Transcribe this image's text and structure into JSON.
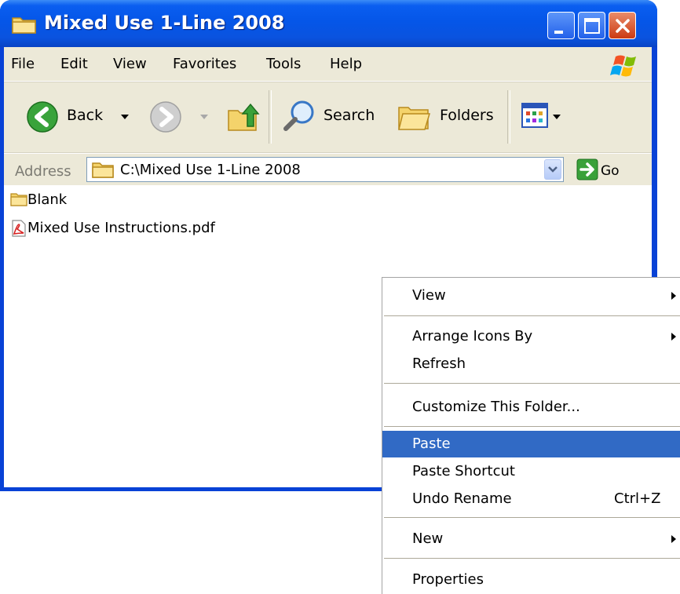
{
  "window": {
    "title": "Mixed Use 1-Line 2008"
  },
  "menubar": {
    "items": [
      "File",
      "Edit",
      "View",
      "Favorites",
      "Tools",
      "Help"
    ]
  },
  "toolbar": {
    "back_label": "Back",
    "search_label": "Search",
    "folders_label": "Folders"
  },
  "addressbar": {
    "label": "Address",
    "value": "C:\\Mixed Use 1-Line 2008",
    "go_label": "Go"
  },
  "files": [
    {
      "name": "Blank",
      "icon": "folder-icon"
    },
    {
      "name": "Mixed Use Instructions.pdf",
      "icon": "pdf-icon"
    }
  ],
  "context_menu": {
    "items": [
      {
        "label": "View",
        "submenu": true
      },
      {
        "label": "Arrange Icons By",
        "submenu": true
      },
      {
        "label": "Refresh"
      },
      {
        "label": "Customize This Folder..."
      },
      {
        "label": "Paste",
        "highlighted": true
      },
      {
        "label": "Paste Shortcut"
      },
      {
        "label": "Undo Rename",
        "shortcut": "Ctrl+Z"
      },
      {
        "label": "New",
        "submenu": true
      },
      {
        "label": "Properties"
      }
    ]
  },
  "colors": {
    "titlebar": "#0a5ef0",
    "menu_highlight": "#316ac5",
    "window_face": "#ece9d8"
  }
}
